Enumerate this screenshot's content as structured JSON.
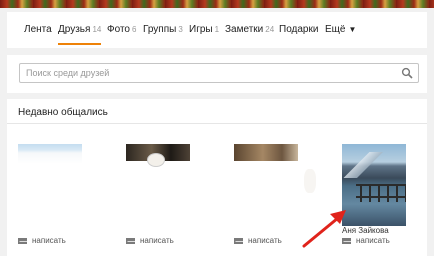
{
  "nav": {
    "items": [
      {
        "label": "Лента",
        "count": ""
      },
      {
        "label": "Друзья",
        "count": "14"
      },
      {
        "label": "Фото",
        "count": "6"
      },
      {
        "label": "Группы",
        "count": "3"
      },
      {
        "label": "Игры",
        "count": "1"
      },
      {
        "label": "Заметки",
        "count": "24"
      },
      {
        "label": "Подарки",
        "count": ""
      },
      {
        "label": "Ещё",
        "count": ""
      }
    ],
    "active": "Друзья"
  },
  "search": {
    "placeholder": "Поиск среди друзей",
    "value": ""
  },
  "recent": {
    "title": "Недавно общались",
    "friends": [
      {
        "name": "",
        "message_label": "написать"
      },
      {
        "name": "",
        "message_label": "написать"
      },
      {
        "name": "",
        "message_label": "написать"
      },
      {
        "name": "Аня Зайкова",
        "message_label": "написать"
      }
    ]
  },
  "colors": {
    "accent": "#ee8208",
    "arrow": "#e0231b"
  },
  "icons": {
    "search": "search-icon",
    "message": "envelope-icon",
    "dropdown": "chevron-down-icon"
  }
}
